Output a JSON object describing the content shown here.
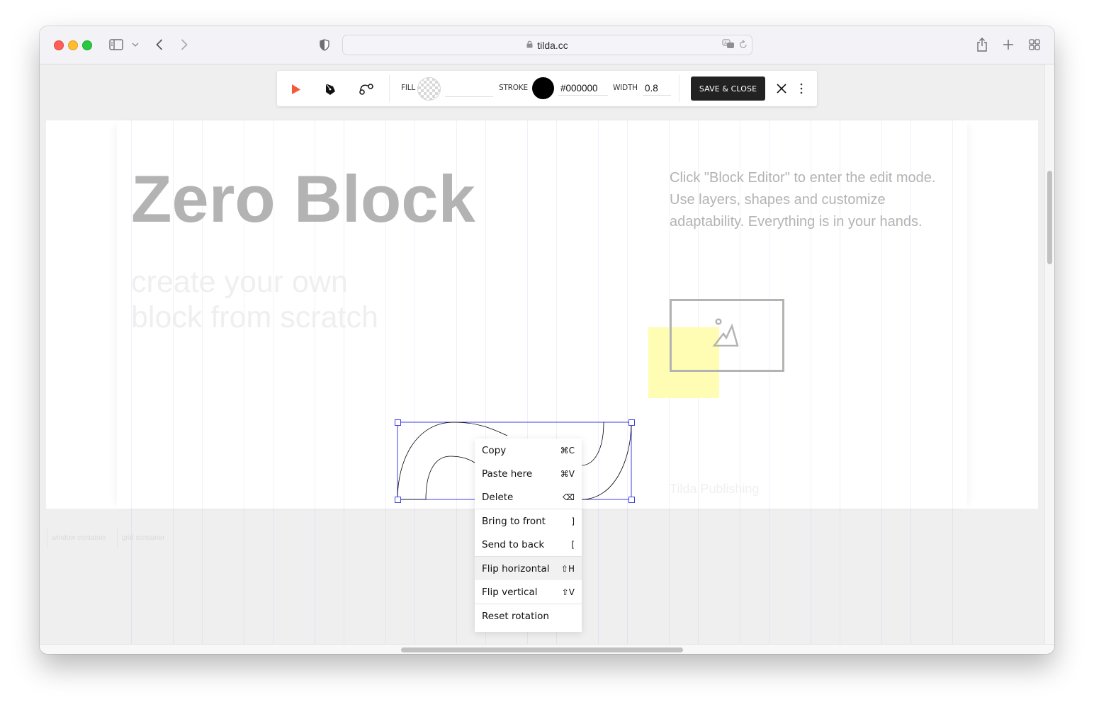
{
  "browser": {
    "url": "tilda.cc",
    "icons": [
      "sidebar-icon",
      "chevron-down-icon",
      "back-icon",
      "forward-icon",
      "privacy-shield-icon",
      "lock-icon",
      "translate-icon",
      "reload-icon",
      "share-icon",
      "new-tab-icon",
      "tab-overview-icon"
    ]
  },
  "toolbar": {
    "tools": [
      "select-arrow-tool",
      "pen-tool",
      "bezier-tool"
    ],
    "fill_label": "FILL",
    "fill_value": "",
    "stroke_label": "STROKE",
    "stroke_value": "#000000",
    "stroke_color": "#000000",
    "width_label": "WIDTH",
    "width_value": "0.8",
    "save_label": "SAVE & CLOSE",
    "accent_color": "#f4593b"
  },
  "canvas": {
    "heading": "Zero Block",
    "subheading_line1": "create your own",
    "subheading_line2": "block from scratch",
    "description": "Click \"Block Editor\" to enter the edit mode. Use layers, shapes and customize adaptability. Everything is in your hands.",
    "brand": "Tilda Publishing",
    "highlight_color": "#fffcb3",
    "selection_color": "#3f3fe0"
  },
  "container_labels": {
    "window": "window container",
    "grid": "grid container"
  },
  "context_menu": {
    "items": [
      {
        "label": "Copy",
        "shortcut": "⌘C"
      },
      {
        "label": "Paste here",
        "shortcut": "⌘V"
      },
      {
        "label": "Delete",
        "shortcut": "⌫"
      },
      {
        "label": "Bring to front",
        "shortcut": "]"
      },
      {
        "label": "Send to back",
        "shortcut": "["
      },
      {
        "label": "Flip horizontal",
        "shortcut": "⇧H"
      },
      {
        "label": "Flip vertical",
        "shortcut": "⇧V"
      },
      {
        "label": "Reset rotation",
        "shortcut": ""
      }
    ],
    "highlighted": "Flip horizontal"
  }
}
